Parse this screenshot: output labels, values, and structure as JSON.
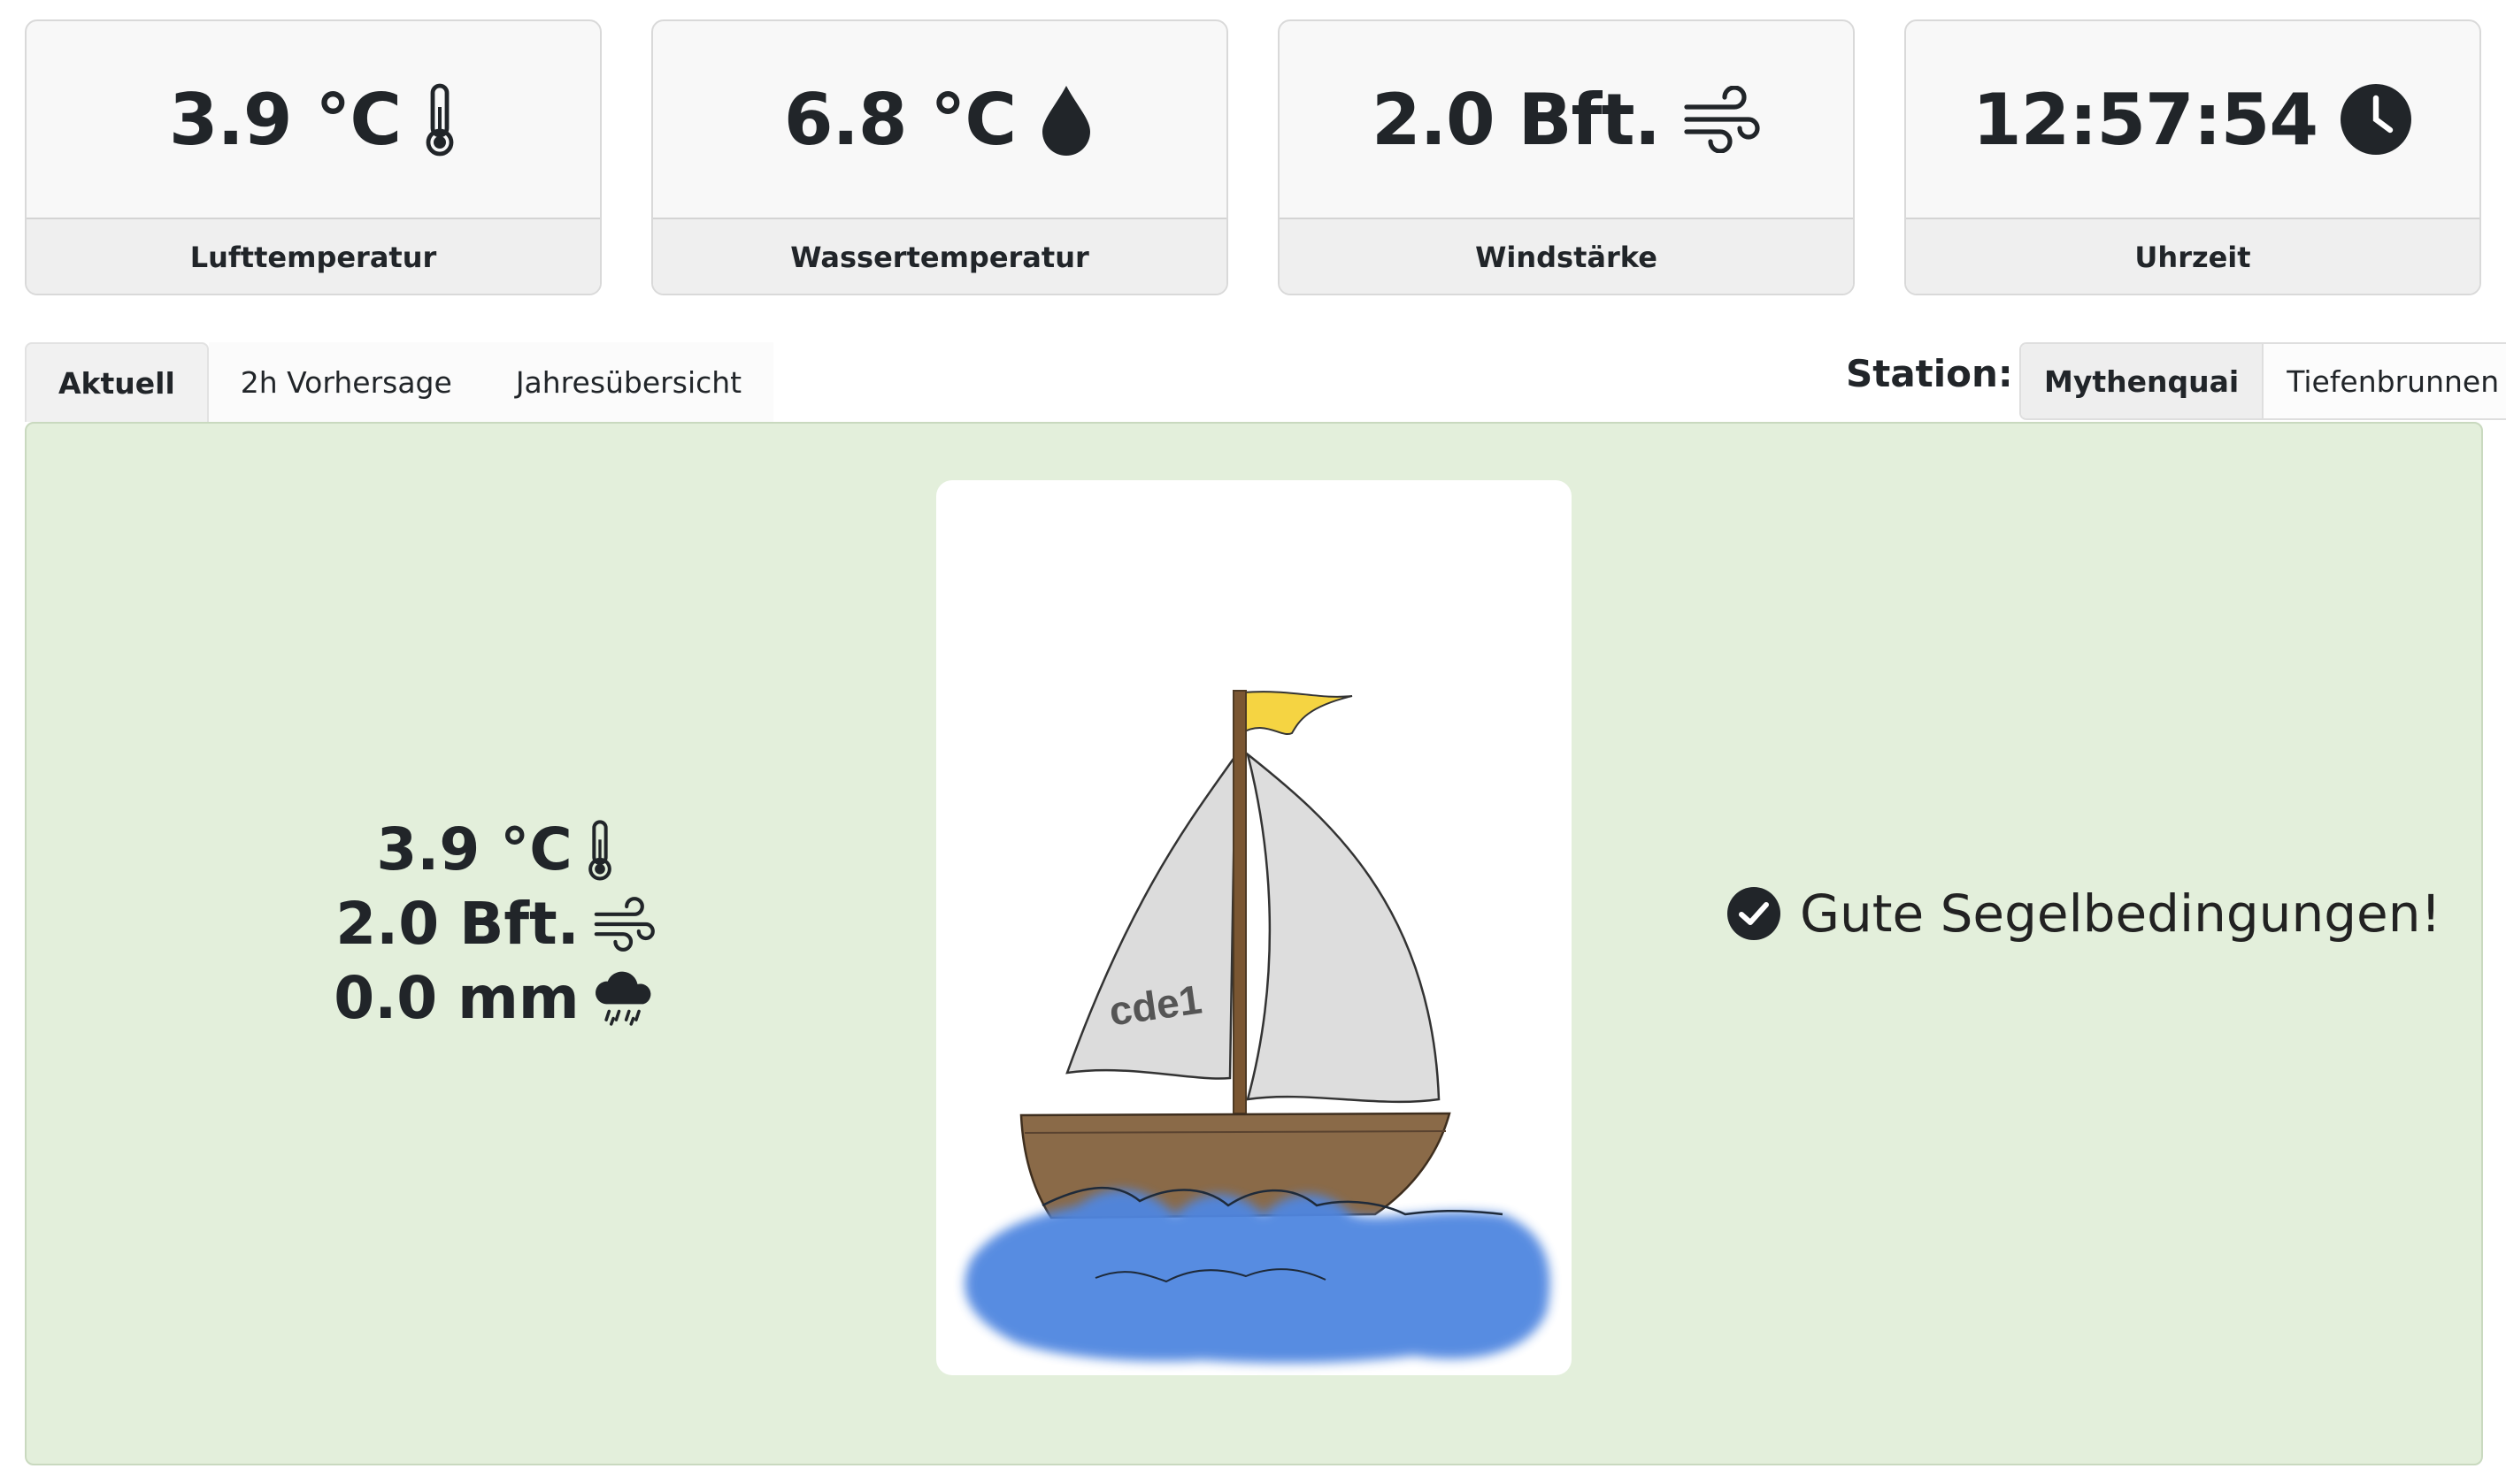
{
  "cards": [
    {
      "value": "3.9 °C",
      "label": "Lufttemperatur",
      "icon": "thermometer-icon"
    },
    {
      "value": "6.8 °C",
      "label": "Wassertemperatur",
      "icon": "droplet-icon"
    },
    {
      "value": "2.0 Bft.",
      "label": "Windstärke",
      "icon": "wind-icon"
    },
    {
      "value": "12:57:54",
      "label": "Uhrzeit",
      "icon": "clock-icon"
    }
  ],
  "tabs": [
    {
      "label": "Aktuell",
      "active": true
    },
    {
      "label": "2h Vorhersage",
      "active": false
    },
    {
      "label": "Jahresübersicht",
      "active": false
    }
  ],
  "station": {
    "label": "Station:",
    "options": [
      {
        "label": "Mythenquai",
        "active": true
      },
      {
        "label": "Tiefenbrunnen",
        "active": false
      }
    ]
  },
  "current": {
    "temperature": "3.9 °C",
    "wind": "2.0 Bft.",
    "precipitation": "0.0 mm",
    "boat_sail_text": "cde1",
    "status_text": "Gute Segelbedingungen!"
  },
  "colors": {
    "panel_bg": "#e3efdb",
    "flag": "#f5d442",
    "water": "#4f86e0",
    "hull": "#7a5632"
  }
}
